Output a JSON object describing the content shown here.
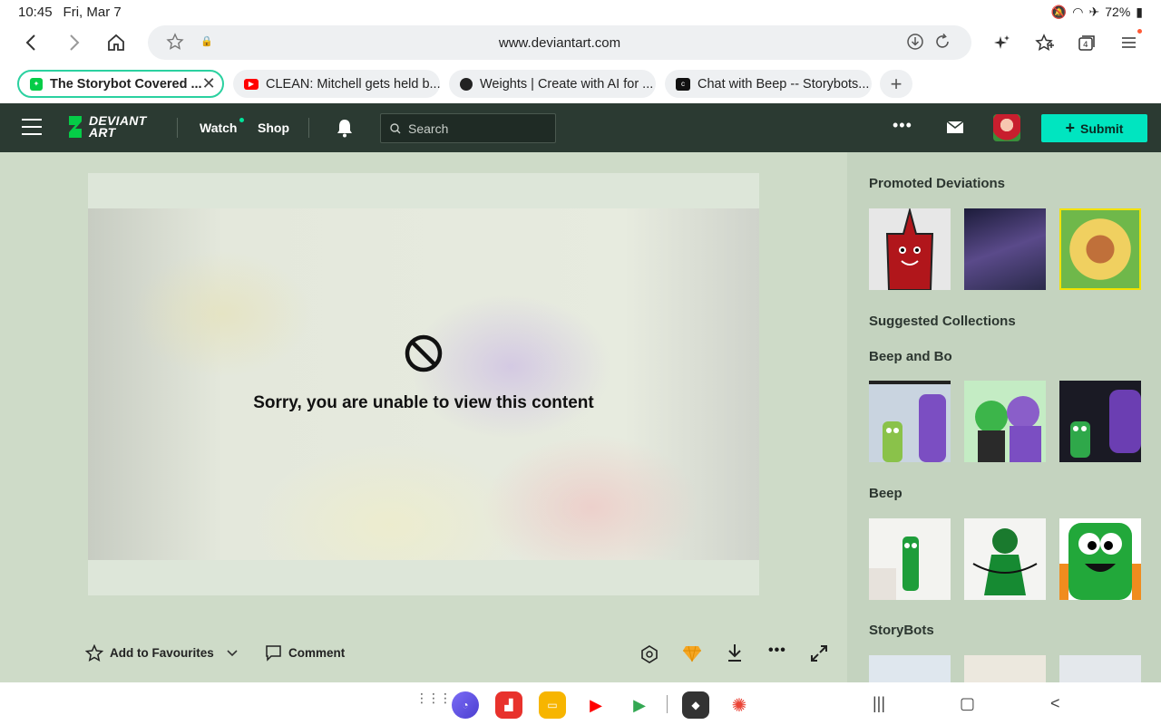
{
  "status": {
    "time": "10:45",
    "date": "Fri, Mar 7",
    "battery": "72%"
  },
  "browser": {
    "url": "www.deviantart.com",
    "tabs": [
      {
        "title": "The Storybot Covered ...",
        "active": true
      },
      {
        "title": "CLEAN: Mitchell gets held b..."
      },
      {
        "title": "Weights | Create with AI for ..."
      },
      {
        "title": "Chat with Beep -- Storybots..."
      }
    ],
    "tab_count": "4"
  },
  "header": {
    "logo_line1": "DEVIANT",
    "logo_line2": "ART",
    "watch": "Watch",
    "shop": "Shop",
    "search_placeholder": "Search",
    "submit": "Submit"
  },
  "viewer": {
    "message": "Sorry, you are unable to view this content"
  },
  "actions": {
    "favourite": "Add to Favourites",
    "comment": "Comment"
  },
  "sidebar": {
    "promoted_title": "Promoted Deviations",
    "suggested_title": "Suggested Collections",
    "collections": [
      {
        "title": "Beep and Bo"
      },
      {
        "title": "Beep"
      },
      {
        "title": "StoryBots"
      }
    ]
  },
  "colors": {
    "da_header": "#2b3a32",
    "submit": "#00e5c0",
    "main_bg": "#cedbc8",
    "sidebar_bg": "#c4d3bf"
  }
}
